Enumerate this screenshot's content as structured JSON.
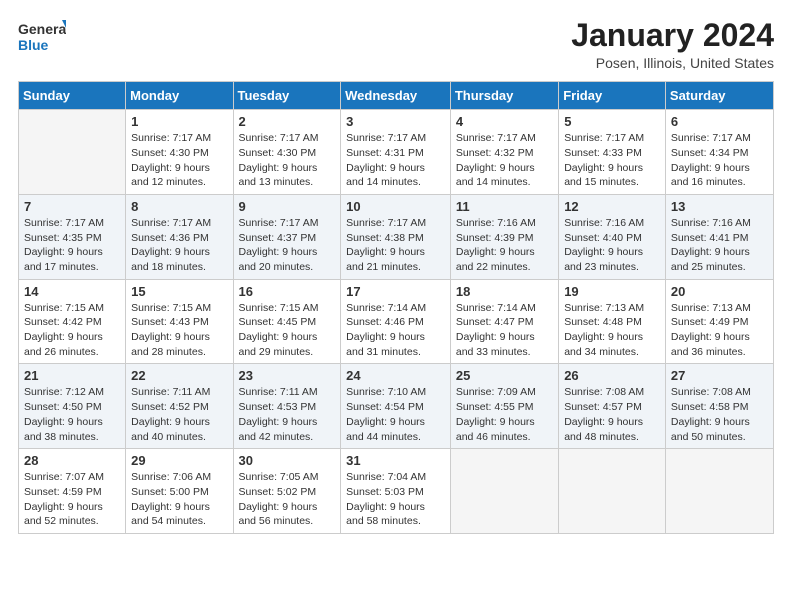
{
  "header": {
    "logo_text_general": "General",
    "logo_text_blue": "Blue",
    "month": "January 2024",
    "location": "Posen, Illinois, United States"
  },
  "weekdays": [
    "Sunday",
    "Monday",
    "Tuesday",
    "Wednesday",
    "Thursday",
    "Friday",
    "Saturday"
  ],
  "weeks": [
    [
      {
        "day": "",
        "info": ""
      },
      {
        "day": "1",
        "info": "Sunrise: 7:17 AM\nSunset: 4:30 PM\nDaylight: 9 hours\nand 12 minutes."
      },
      {
        "day": "2",
        "info": "Sunrise: 7:17 AM\nSunset: 4:30 PM\nDaylight: 9 hours\nand 13 minutes."
      },
      {
        "day": "3",
        "info": "Sunrise: 7:17 AM\nSunset: 4:31 PM\nDaylight: 9 hours\nand 14 minutes."
      },
      {
        "day": "4",
        "info": "Sunrise: 7:17 AM\nSunset: 4:32 PM\nDaylight: 9 hours\nand 14 minutes."
      },
      {
        "day": "5",
        "info": "Sunrise: 7:17 AM\nSunset: 4:33 PM\nDaylight: 9 hours\nand 15 minutes."
      },
      {
        "day": "6",
        "info": "Sunrise: 7:17 AM\nSunset: 4:34 PM\nDaylight: 9 hours\nand 16 minutes."
      }
    ],
    [
      {
        "day": "7",
        "info": "Sunrise: 7:17 AM\nSunset: 4:35 PM\nDaylight: 9 hours\nand 17 minutes."
      },
      {
        "day": "8",
        "info": "Sunrise: 7:17 AM\nSunset: 4:36 PM\nDaylight: 9 hours\nand 18 minutes."
      },
      {
        "day": "9",
        "info": "Sunrise: 7:17 AM\nSunset: 4:37 PM\nDaylight: 9 hours\nand 20 minutes."
      },
      {
        "day": "10",
        "info": "Sunrise: 7:17 AM\nSunset: 4:38 PM\nDaylight: 9 hours\nand 21 minutes."
      },
      {
        "day": "11",
        "info": "Sunrise: 7:16 AM\nSunset: 4:39 PM\nDaylight: 9 hours\nand 22 minutes."
      },
      {
        "day": "12",
        "info": "Sunrise: 7:16 AM\nSunset: 4:40 PM\nDaylight: 9 hours\nand 23 minutes."
      },
      {
        "day": "13",
        "info": "Sunrise: 7:16 AM\nSunset: 4:41 PM\nDaylight: 9 hours\nand 25 minutes."
      }
    ],
    [
      {
        "day": "14",
        "info": "Sunrise: 7:15 AM\nSunset: 4:42 PM\nDaylight: 9 hours\nand 26 minutes."
      },
      {
        "day": "15",
        "info": "Sunrise: 7:15 AM\nSunset: 4:43 PM\nDaylight: 9 hours\nand 28 minutes."
      },
      {
        "day": "16",
        "info": "Sunrise: 7:15 AM\nSunset: 4:45 PM\nDaylight: 9 hours\nand 29 minutes."
      },
      {
        "day": "17",
        "info": "Sunrise: 7:14 AM\nSunset: 4:46 PM\nDaylight: 9 hours\nand 31 minutes."
      },
      {
        "day": "18",
        "info": "Sunrise: 7:14 AM\nSunset: 4:47 PM\nDaylight: 9 hours\nand 33 minutes."
      },
      {
        "day": "19",
        "info": "Sunrise: 7:13 AM\nSunset: 4:48 PM\nDaylight: 9 hours\nand 34 minutes."
      },
      {
        "day": "20",
        "info": "Sunrise: 7:13 AM\nSunset: 4:49 PM\nDaylight: 9 hours\nand 36 minutes."
      }
    ],
    [
      {
        "day": "21",
        "info": "Sunrise: 7:12 AM\nSunset: 4:50 PM\nDaylight: 9 hours\nand 38 minutes."
      },
      {
        "day": "22",
        "info": "Sunrise: 7:11 AM\nSunset: 4:52 PM\nDaylight: 9 hours\nand 40 minutes."
      },
      {
        "day": "23",
        "info": "Sunrise: 7:11 AM\nSunset: 4:53 PM\nDaylight: 9 hours\nand 42 minutes."
      },
      {
        "day": "24",
        "info": "Sunrise: 7:10 AM\nSunset: 4:54 PM\nDaylight: 9 hours\nand 44 minutes."
      },
      {
        "day": "25",
        "info": "Sunrise: 7:09 AM\nSunset: 4:55 PM\nDaylight: 9 hours\nand 46 minutes."
      },
      {
        "day": "26",
        "info": "Sunrise: 7:08 AM\nSunset: 4:57 PM\nDaylight: 9 hours\nand 48 minutes."
      },
      {
        "day": "27",
        "info": "Sunrise: 7:08 AM\nSunset: 4:58 PM\nDaylight: 9 hours\nand 50 minutes."
      }
    ],
    [
      {
        "day": "28",
        "info": "Sunrise: 7:07 AM\nSunset: 4:59 PM\nDaylight: 9 hours\nand 52 minutes."
      },
      {
        "day": "29",
        "info": "Sunrise: 7:06 AM\nSunset: 5:00 PM\nDaylight: 9 hours\nand 54 minutes."
      },
      {
        "day": "30",
        "info": "Sunrise: 7:05 AM\nSunset: 5:02 PM\nDaylight: 9 hours\nand 56 minutes."
      },
      {
        "day": "31",
        "info": "Sunrise: 7:04 AM\nSunset: 5:03 PM\nDaylight: 9 hours\nand 58 minutes."
      },
      {
        "day": "",
        "info": ""
      },
      {
        "day": "",
        "info": ""
      },
      {
        "day": "",
        "info": ""
      }
    ]
  ]
}
